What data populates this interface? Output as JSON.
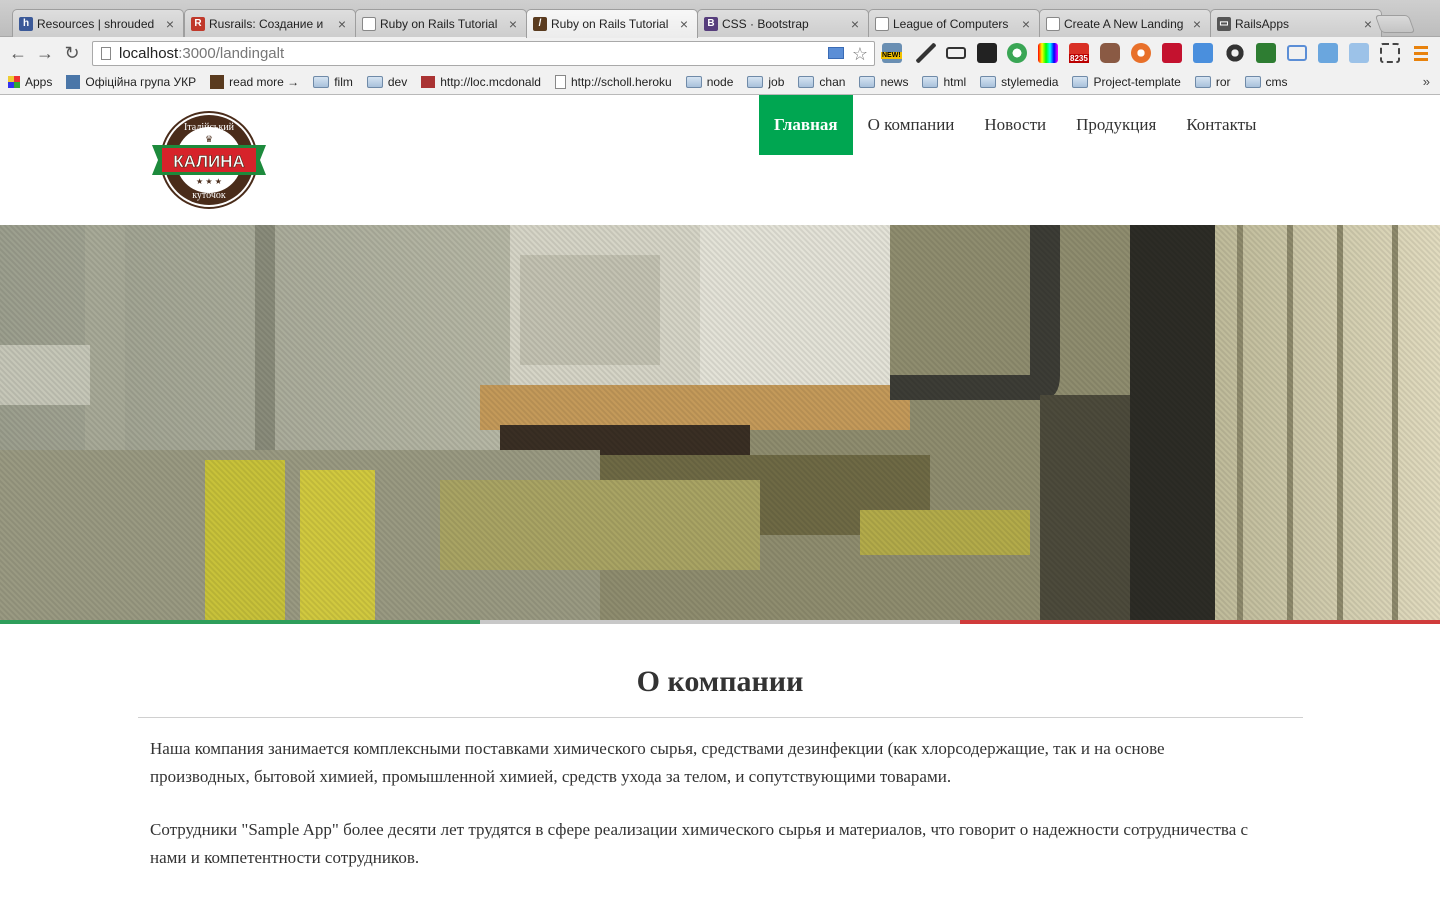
{
  "browser": {
    "tabs": [
      {
        "label": "Resources | shrouded",
        "favicon": "h-icon",
        "color": "#3b5998",
        "glyph": "h"
      },
      {
        "label": "Rusrails: Создание и",
        "favicon": "r-icon",
        "color": "#c0392b",
        "glyph": "R"
      },
      {
        "label": "Ruby on Rails Tutorial",
        "favicon": "page-icon",
        "color": "#ffffff",
        "glyph": ""
      },
      {
        "label": "Ruby on Rails Tutorial",
        "favicon": "ruby-icon",
        "color": "#5a3b1f",
        "glyph": "/"
      },
      {
        "label": "CSS · Bootstrap",
        "favicon": "bootstrap-icon",
        "color": "#563d7c",
        "glyph": "B"
      },
      {
        "label": "League of Computers",
        "favicon": "page-icon",
        "color": "#ffffff",
        "glyph": ""
      },
      {
        "label": "Create A New Landing",
        "favicon": "page-icon",
        "color": "#ffffff",
        "glyph": ""
      },
      {
        "label": "RailsApps",
        "favicon": "railsapps-icon",
        "color": "#444444",
        "glyph": "▭"
      }
    ],
    "active_tab_index": 3,
    "url_host": "localhost",
    "url_path": ":3000/landingalt",
    "bookmarks": [
      {
        "label": "Apps",
        "icon": "apps-icon"
      },
      {
        "label": "Офіційна група УКР",
        "icon": "vk-icon"
      },
      {
        "label": "read more →",
        "icon": "ruby-icon"
      },
      {
        "label": "film",
        "icon": "folder-icon"
      },
      {
        "label": "dev",
        "icon": "folder-icon"
      },
      {
        "label": "http://loc.mcdonald",
        "icon": "mcd-icon"
      },
      {
        "label": "http://scholl.heroku",
        "icon": "doc-icon"
      },
      {
        "label": "node",
        "icon": "folder-icon"
      },
      {
        "label": "job",
        "icon": "folder-icon"
      },
      {
        "label": "chan",
        "icon": "folder-icon"
      },
      {
        "label": "news",
        "icon": "folder-icon"
      },
      {
        "label": "html",
        "icon": "folder-icon"
      },
      {
        "label": "stylemedia",
        "icon": "folder-icon"
      },
      {
        "label": "Project-template",
        "icon": "folder-icon"
      },
      {
        "label": "ror",
        "icon": "folder-icon"
      },
      {
        "label": "cms",
        "icon": "folder-icon"
      }
    ],
    "mail_badge": "8235",
    "new_badge": "NEW!"
  },
  "site": {
    "logo": {
      "top_text": "Італійський",
      "main_text": "КАЛИНА",
      "bottom_text": "куточок"
    },
    "nav": [
      {
        "label": "Главная",
        "active": true
      },
      {
        "label": "О компании",
        "active": false
      },
      {
        "label": "Новости",
        "active": false
      },
      {
        "label": "Продукция",
        "active": false
      },
      {
        "label": "Контакты",
        "active": false
      }
    ],
    "accent_color": "#00a651",
    "stripe_colors": [
      "#2e9e5b",
      "#c8c8c8",
      "#d03b3b"
    ],
    "about": {
      "title": "О компании",
      "paragraphs": [
        "Наша компания занимается комплексными поставками химического сырья, средствами дезинфекции (как хлорсодержащие, так и на основе производных, бытовой химией, промышленной химией, средств ухода за телом, и сопутствующими товарами.",
        "Сотрудники \"Sample App\" более десяти лет трудятся в сфере реализации химического сырья и материалов, что говорит о надежности сотрудничества с нами и компетентности сотрудников."
      ]
    }
  }
}
